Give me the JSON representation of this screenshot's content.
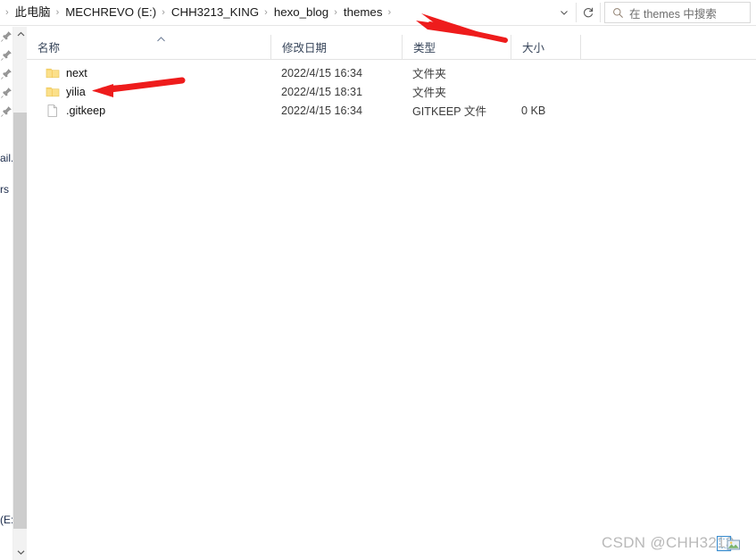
{
  "window": {
    "app": "windows-file-explorer",
    "accent_color": "#ffd966",
    "annotation_color": "#ee1c1c"
  },
  "addressbar": {
    "separator": "›",
    "crumbs": [
      {
        "label": "此电脑"
      },
      {
        "label": "MECHREVO (E:)"
      },
      {
        "label": "CHH3213_KING"
      },
      {
        "label": "hexo_blog"
      },
      {
        "label": "themes"
      }
    ],
    "history_dropdown": "chevron-down-icon",
    "refresh": "refresh-icon"
  },
  "search": {
    "icon": "search-icon",
    "placeholder": "在 themes 中搜索",
    "value": ""
  },
  "nav_pane": {
    "pin_count": 5,
    "pin_icon": "pin-icon",
    "fragments": [
      {
        "text": "ail."
      },
      {
        "text": "rs"
      },
      {
        "text": "(E:"
      }
    ]
  },
  "scrollbar": {
    "up_arrow": "chevron-up-icon",
    "down_arrow": "chevron-down-icon"
  },
  "filelist": {
    "sort_indicator": "sort-ascending-icon",
    "columns": [
      {
        "key": "name",
        "label": "名称"
      },
      {
        "key": "date",
        "label": "修改日期"
      },
      {
        "key": "type",
        "label": "类型"
      },
      {
        "key": "size",
        "label": "大小"
      }
    ],
    "rows": [
      {
        "icon": "folder-icon",
        "name": "next",
        "date": "2022/4/15 16:34",
        "type": "文件夹",
        "size": ""
      },
      {
        "icon": "folder-icon",
        "name": "yilia",
        "date": "2022/4/15 18:31",
        "type": "文件夹",
        "size": ""
      },
      {
        "icon": "file-icon",
        "name": ".gitkeep",
        "date": "2022/4/15 16:34",
        "type": "GITKEEP 文件",
        "size": "0 KB"
      }
    ]
  },
  "annotations": [
    {
      "name": "arrow-to-breadcrumb-end",
      "points_to": "themes breadcrumb chevron"
    },
    {
      "name": "arrow-to-yilia-folder",
      "points_to": "yilia"
    }
  ],
  "watermark": {
    "text": "CSDN @CHH3213",
    "icon": "image-thumbnail-icon"
  }
}
